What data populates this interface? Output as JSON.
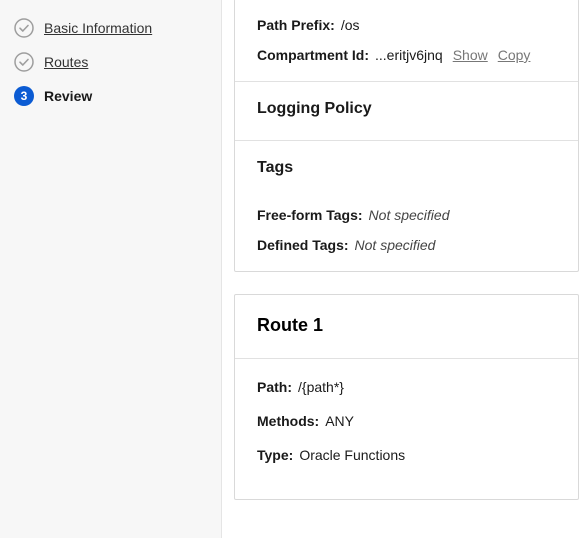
{
  "sidebar": {
    "steps": [
      {
        "label": "Basic Information",
        "done": true
      },
      {
        "label": "Routes",
        "done": true
      },
      {
        "label": "Review",
        "number": "3",
        "current": true
      }
    ]
  },
  "basic": {
    "pathPrefixLabel": "Path Prefix:",
    "pathPrefixValue": "/os",
    "compartmentLabel": "Compartment Id:",
    "compartmentValue": "...eritjv6jnq",
    "showLabel": "Show",
    "copyLabel": "Copy"
  },
  "logging": {
    "title": "Logging Policy"
  },
  "tags": {
    "title": "Tags",
    "freeformLabel": "Free-form Tags:",
    "freeformValue": "Not specified",
    "definedLabel": "Defined Tags:",
    "definedValue": "Not specified"
  },
  "route": {
    "title": "Route 1",
    "pathLabel": "Path:",
    "pathValue": "/{path*}",
    "methodsLabel": "Methods:",
    "methodsValue": "ANY",
    "typeLabel": "Type:",
    "typeValue": "Oracle Functions"
  }
}
